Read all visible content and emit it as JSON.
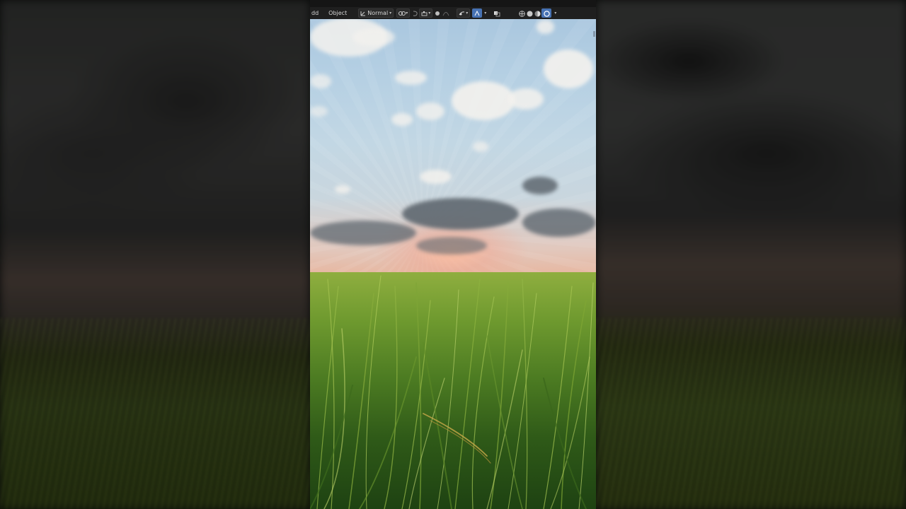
{
  "toolbar": {
    "menu_add": "Add",
    "menu_add_visible": "dd",
    "menu_object": "Object",
    "orientation_value": "Normal",
    "icons": [
      "transform-orientation-icon",
      "pivot-point-icon",
      "snap-icon",
      "snap-target-icon",
      "proportional-edit-icon",
      "falloff-icon",
      "viewport-gizmo-icon",
      "overlays-icon",
      "xray-icon",
      "wireframe-shading-icon",
      "solid-shading-icon",
      "material-preview-icon",
      "rendered-shading-icon"
    ],
    "colors": {
      "bar": "#1f1f1f",
      "active": "#4772b3"
    }
  },
  "scene": {
    "description_colors": {
      "sky_top": "#a6c4dd",
      "horizon": "#e6b9a4",
      "grass": "#4c7b22"
    }
  }
}
